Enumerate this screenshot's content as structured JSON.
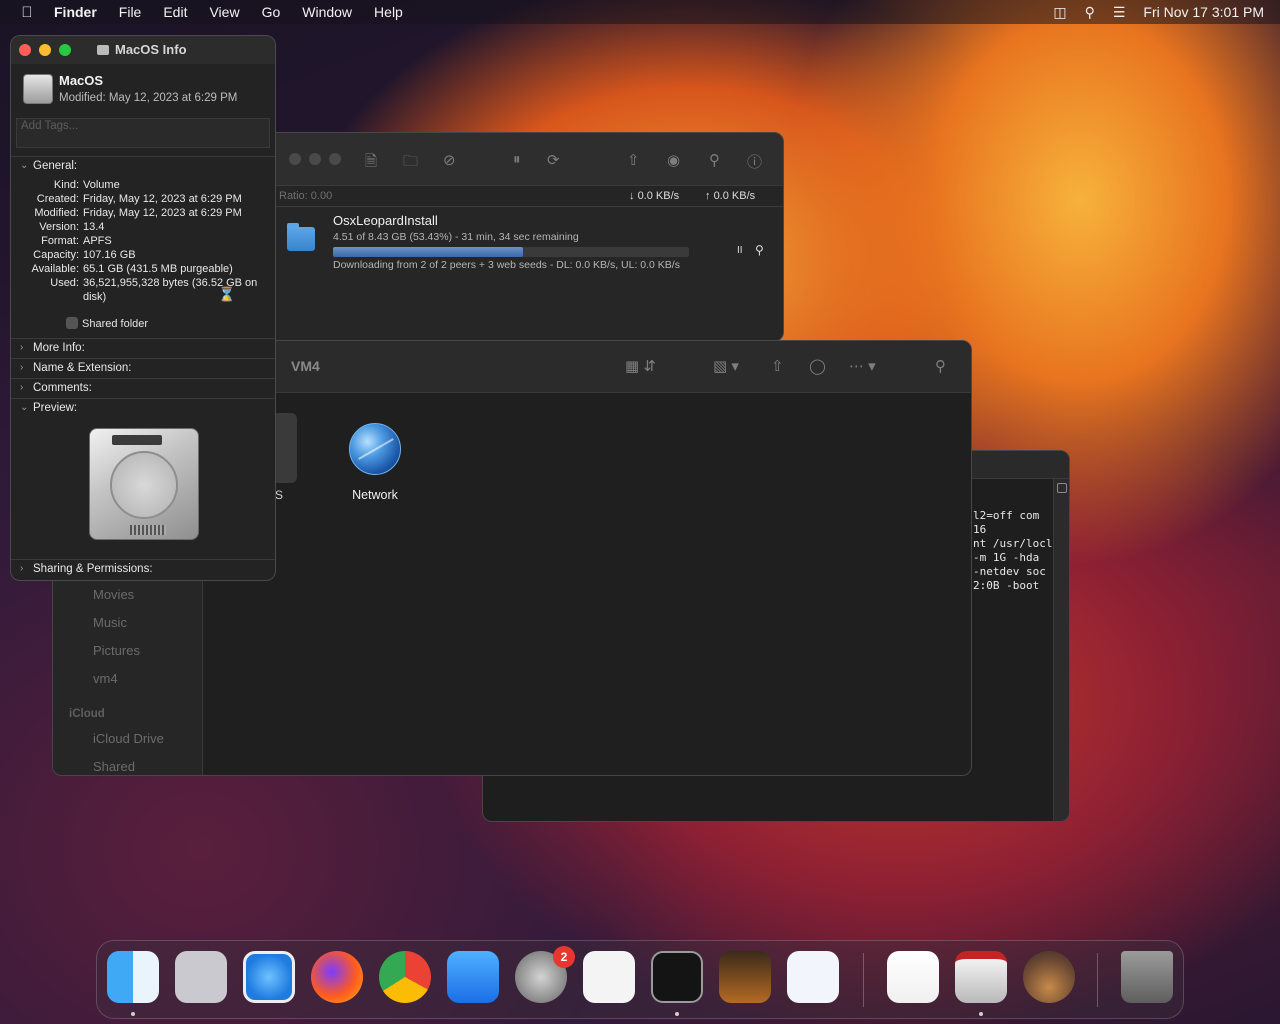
{
  "menubar": {
    "apple": "",
    "app_name": "Finder",
    "items": [
      "File",
      "Edit",
      "View",
      "Go",
      "Window",
      "Help"
    ],
    "clock": "Fri Nov 17  3:01 PM",
    "status_icons": [
      "screen-mirroring-icon",
      "search-icon",
      "control-center-icon"
    ]
  },
  "torrent": {
    "ratio": "Ratio: 0.00",
    "download_rate": "0.0 KB/s",
    "upload_rate": "0.0 KB/s",
    "name": "OsxLeopardInstall",
    "progress_text": "4.51 of 8.43 GB (53.43%) - 31 min, 34 sec remaining",
    "progress_fraction": 0.5343,
    "peers_text": "Downloading from 2 of 2 peers + 3 web seeds - DL: 0.0 KB/s, UL: 0.0 KB/s",
    "pause_glyph": "II"
  },
  "terminal": {
    "lines": [
      "l2=off com",
      "16",
      "nt /usr/locl",
      "-m 1G -hda",
      "-netdev soc",
      "2:0B -boot"
    ]
  },
  "finder": {
    "title": "VM4",
    "sidebar": {
      "items": [
        "Movies",
        "Music",
        "Pictures",
        "vm4"
      ],
      "icloud_header": "iCloud",
      "icloud_items": [
        "iCloud Drive",
        "Shared"
      ]
    },
    "items": [
      {
        "label": "Network",
        "icon": "network-globe-icon"
      }
    ],
    "peek_label": "S"
  },
  "info": {
    "title": "MacOS Info",
    "name": "MacOS",
    "modified_header": "Modified: May 12, 2023 at 6:29 PM",
    "tags_placeholder": "Add Tags...",
    "sections": {
      "general": "General:",
      "more_info": "More Info:",
      "name_ext": "Name & Extension:",
      "comments": "Comments:",
      "preview": "Preview:",
      "sharing": "Sharing & Permissions:"
    },
    "general": {
      "kind_k": "Kind:",
      "kind": "Volume",
      "created_k": "Created:",
      "created": "Friday, May 12, 2023 at 6:29 PM",
      "modified_k": "Modified:",
      "modified": "Friday, May 12, 2023 at 6:29 PM",
      "version_k": "Version:",
      "version": "13.4",
      "format_k": "Format:",
      "format": "APFS",
      "capacity_k": "Capacity:",
      "capacity": "107.16 GB",
      "available_k": "Available:",
      "available": "65.1 GB (431.5 MB purgeable)",
      "used_k": "Used:",
      "used": "36,521,955,328 bytes (36.52 GB on disk)"
    },
    "shared_folder": "Shared folder"
  },
  "dock": {
    "apps": [
      "finder-icon",
      "launchpad-icon",
      "safari-icon",
      "firefox-icon",
      "chrome-icon",
      "app-store-icon",
      "system-settings-icon",
      "textedit-icon",
      "terminal-icon",
      "garageband-icon",
      "vscode-icon",
      "home-icon",
      "transmission-icon",
      "macos-installer-icon",
      "trash-icon"
    ],
    "settings_badge": "2"
  },
  "colors": {
    "close": "#fe5f57",
    "minimize": "#febc2e",
    "zoom": "#28c840",
    "progress": "#4a78b8",
    "badge": "#e8372f"
  }
}
